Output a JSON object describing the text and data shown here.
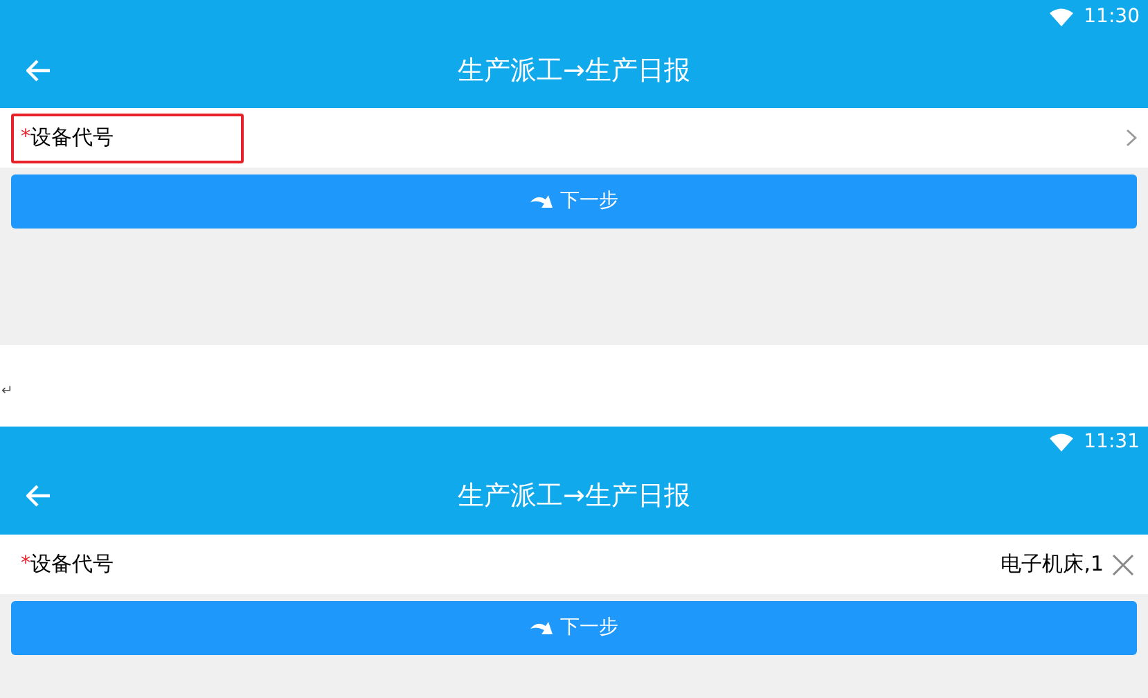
{
  "screens": [
    {
      "status_time": "11:30",
      "title": "生产派工→生产日报",
      "field": {
        "marker": "*",
        "label": "设备代号",
        "highlighted": true
      },
      "next_button": "下一步"
    },
    {
      "status_time": "11:31",
      "title": "生产派工→生产日报",
      "field": {
        "marker": "*",
        "label": "设备代号",
        "highlighted": false,
        "value": "电子机床,1"
      },
      "next_button": "下一步"
    }
  ],
  "paragraph_mark": "↵"
}
